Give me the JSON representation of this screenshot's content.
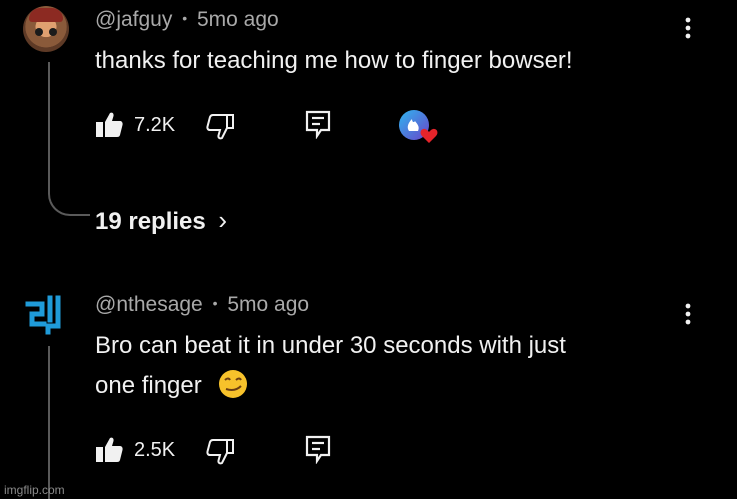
{
  "comments": [
    {
      "handle": "@jafguy",
      "separator": "•",
      "age": "5mo ago",
      "text": "thanks for teaching me how to finger bowser!",
      "likes": "7.2K",
      "replies_label": "19 replies",
      "replies_chevron": "›"
    },
    {
      "handle": "@nthesage",
      "separator": "•",
      "age": "5mo ago",
      "text_line1": "Bro can beat it in under 30 seconds with just",
      "text_line2": "one finger",
      "emoji": "😏",
      "likes": "2.5K"
    }
  ],
  "icons": {
    "like": "thumbs-up-icon",
    "dislike": "thumbs-down-icon",
    "reply": "reply-icon",
    "more": "more-vertical-icon",
    "creator_heart": "creator-heart-icon"
  },
  "watermark": "imgflip.com"
}
